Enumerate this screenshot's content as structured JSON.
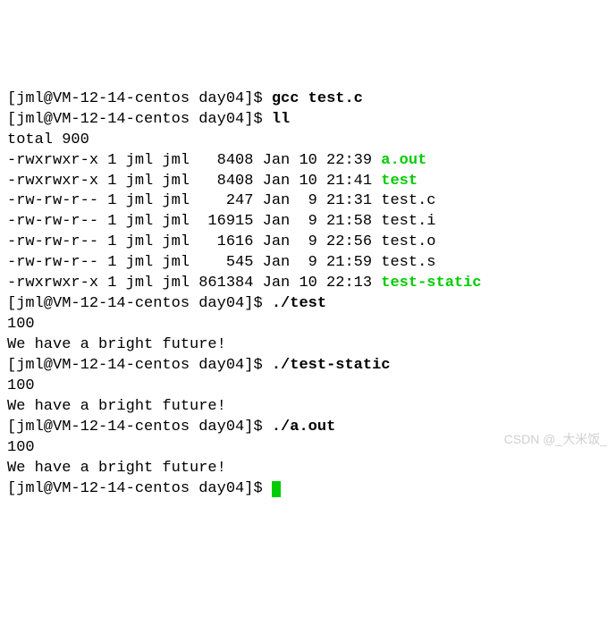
{
  "prompt": "[jml@VM-12-14-centos day04]$ ",
  "cmd1": "gcc test.c",
  "cmd2": "ll",
  "total": "total 900",
  "rows": [
    {
      "perm": "-rwxrwxr-x 1 jml jml   8408 Jan 10 22:39 ",
      "name": "a.out",
      "exec": true
    },
    {
      "perm": "-rwxrwxr-x 1 jml jml   8408 Jan 10 21:41 ",
      "name": "test",
      "exec": true
    },
    {
      "perm": "-rw-rw-r-- 1 jml jml    247 Jan  9 21:31 ",
      "name": "test.c",
      "exec": false
    },
    {
      "perm": "-rw-rw-r-- 1 jml jml  16915 Jan  9 21:58 ",
      "name": "test.i",
      "exec": false
    },
    {
      "perm": "-rw-rw-r-- 1 jml jml   1616 Jan  9 22:56 ",
      "name": "test.o",
      "exec": false
    },
    {
      "perm": "-rw-rw-r-- 1 jml jml    545 Jan  9 21:59 ",
      "name": "test.s",
      "exec": false
    },
    {
      "perm": "-rwxrwxr-x 1 jml jml 861384 Jan 10 22:13 ",
      "name": "test-static",
      "exec": true
    }
  ],
  "cmd3": "./test",
  "out_100": "100",
  "out_msg": "We have a bright future!",
  "cmd4": "./test-static",
  "cmd5": "./a.out",
  "watermark": "CSDN @_大米饭_"
}
